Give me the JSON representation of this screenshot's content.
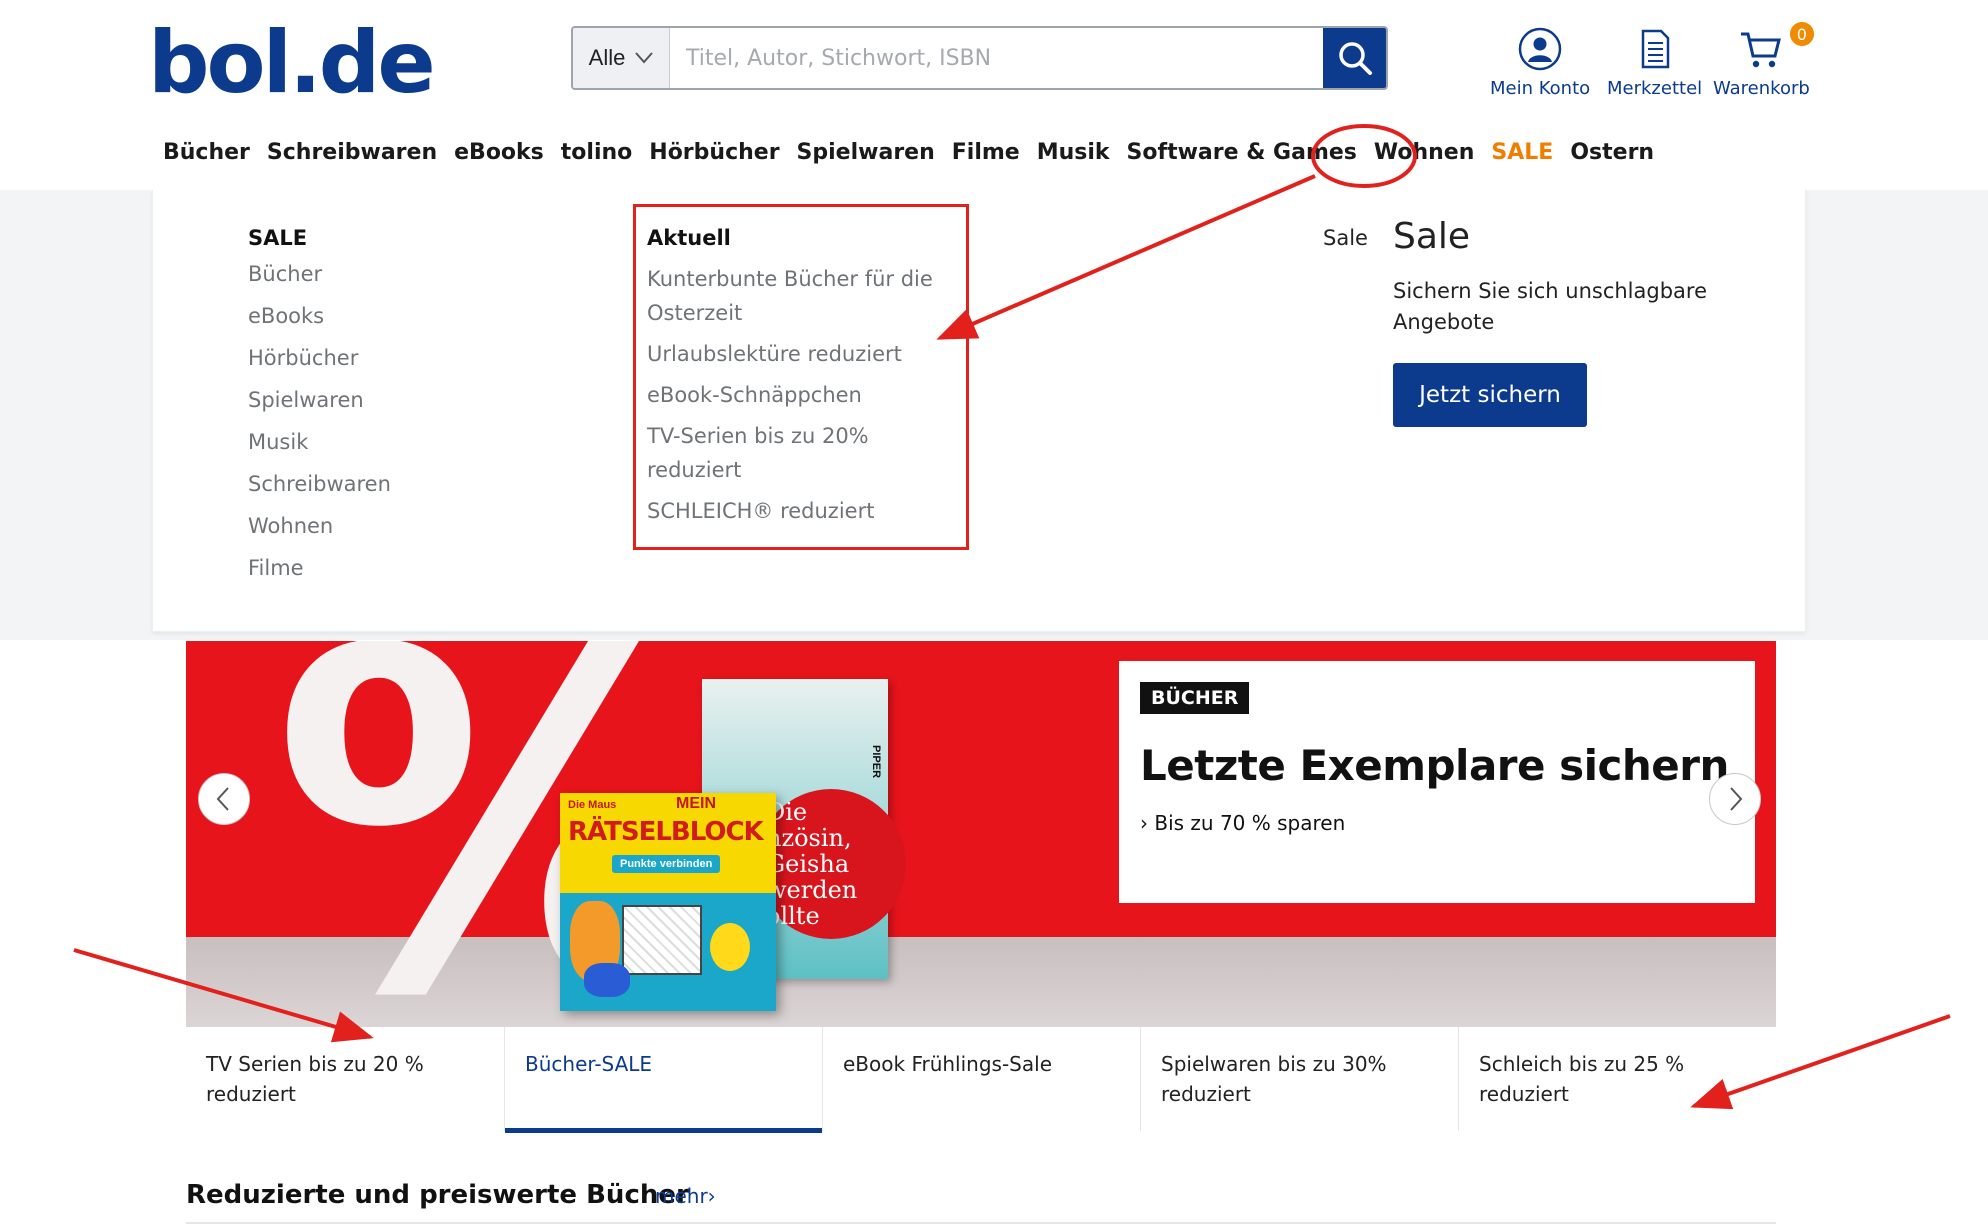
{
  "header": {
    "logo": "bol.de",
    "search": {
      "category": "Alle",
      "placeholder": "Titel, Autor, Stichwort, ISBN"
    },
    "account_label": "Mein Konto",
    "wishlist_label": "Merkzettel",
    "cart_label": "Warenkorb",
    "cart_count": "0"
  },
  "nav": {
    "items": [
      "Bücher",
      "Schreibwaren",
      "eBooks",
      "tolino",
      "Hörbücher",
      "Spielwaren",
      "Filme",
      "Musik",
      "Software & Games",
      "Wohnen",
      "SALE",
      "Ostern"
    ]
  },
  "dropdown": {
    "col1": {
      "heading": "SALE",
      "items": [
        "Bücher",
        "eBooks",
        "Hörbücher",
        "Spielwaren",
        "Musik",
        "Schreibwaren",
        "Wohnen",
        "Filme"
      ]
    },
    "col2": {
      "heading": "Aktuell",
      "items": [
        "Kunterbunte Bücher für die Osterzeit",
        "Urlaubslektüre reduziert",
        "eBook-Schnäppchen",
        "TV-Serien bis zu 20% reduziert",
        "SCHLEICH® reduziert"
      ]
    },
    "promo": {
      "label_small": "Sale",
      "title": "Sale",
      "description": "Sichern Sie sich unschlagbare Angebote",
      "cta": "Jetzt sichern"
    }
  },
  "hero": {
    "percent_glyph": "%",
    "book1": {
      "title": "Die Französin, die eine Geisha werden wollte",
      "visible_title": "Die\nnzösin,\nGeisha\nwerden\nollte",
      "publisher": "PIPER"
    },
    "book2": {
      "brand": "Die Maus",
      "mein": "MEIN",
      "title": "RÄTSELBLOCK",
      "subtitle": "Punkte verbinden"
    },
    "tag": "BÜCHER",
    "title": "Letzte Exemplare sichern",
    "subtitle": "Bis zu 70 % sparen"
  },
  "tabs": [
    {
      "label": "TV Serien bis zu 20 % reduziert",
      "active": false
    },
    {
      "label": "Bücher-SALE",
      "active": true
    },
    {
      "label": "eBook Frühlings-Sale",
      "active": false
    },
    {
      "label": "Spielwaren bis zu 30% reduziert",
      "active": false
    },
    {
      "label": "Schleich bis zu 25 % reduziert",
      "active": false
    }
  ],
  "section": {
    "title": "Reduzierte und preiswerte Bücher",
    "more": "mehr›"
  },
  "colors": {
    "brand": "#0c3b8d",
    "sale": "#f07d00",
    "annotation": "#e2211c",
    "hero_bg": "#e8141c"
  }
}
